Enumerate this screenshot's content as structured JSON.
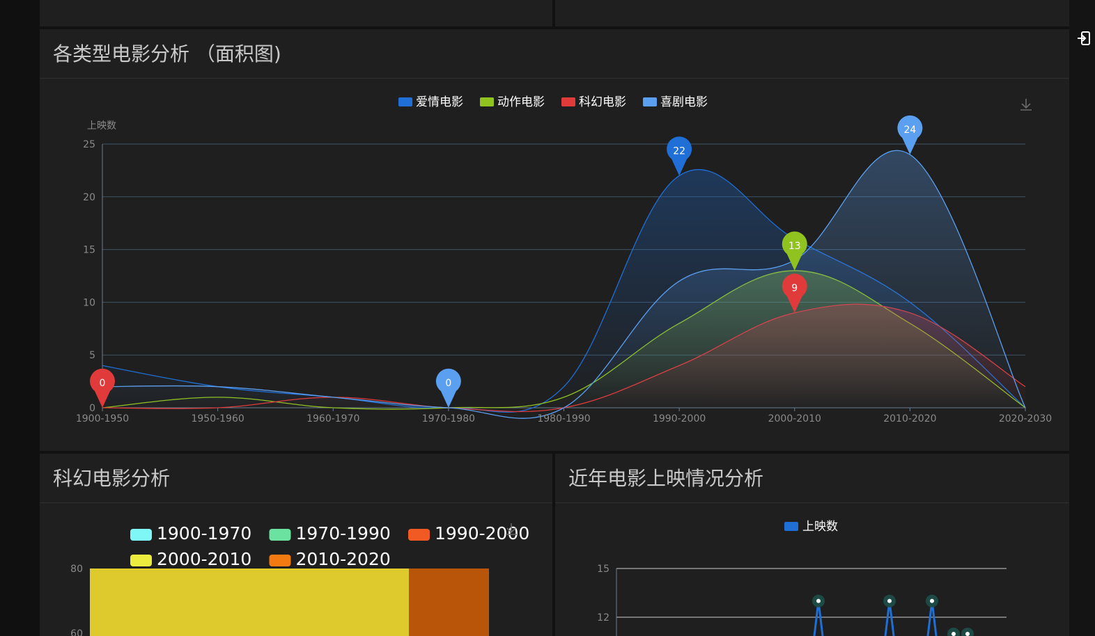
{
  "header": {
    "logout_label": "退出",
    "logout_icon": "logout-icon"
  },
  "panels": {
    "area": {
      "title": "各类型电影分析 （面积图)"
    },
    "scifi": {
      "title": "科幻电影分析"
    },
    "recent": {
      "title": "近年电影上映情况分析"
    }
  },
  "chart_data": [
    {
      "type": "area",
      "title": "各类型电影分析 （面积图)",
      "ylabel": "上映数",
      "ylim": [
        0,
        25
      ],
      "yticks": [
        0,
        5,
        10,
        15,
        20,
        25
      ],
      "grid": true,
      "legend_position": "top-center",
      "categories": [
        "1900-1950",
        "1950-1960",
        "1960-1970",
        "1970-1980",
        "1980-1990",
        "1990-2000",
        "2000-2010",
        "2010-2020",
        "2020-2030"
      ],
      "series": [
        {
          "name": "爱情电影",
          "color": "#1f6fd6",
          "values": [
            4,
            2,
            1,
            0,
            2,
            22,
            16,
            10,
            0
          ]
        },
        {
          "name": "动作电影",
          "color": "#91c320",
          "values": [
            0,
            1,
            0,
            0,
            1,
            8,
            13,
            8,
            0
          ]
        },
        {
          "name": "科幻电影",
          "color": "#e03a3a",
          "values": [
            0,
            0,
            1,
            0,
            0,
            4,
            9,
            9,
            2
          ]
        },
        {
          "name": "喜剧电影",
          "color": "#5b9ff0",
          "values": [
            2,
            2,
            1,
            0,
            0,
            12,
            14,
            24,
            0
          ]
        }
      ],
      "markers": [
        {
          "series": "科幻电影",
          "category": "1900-1950",
          "label": "0"
        },
        {
          "series": "喜剧电影",
          "category": "1970-1980",
          "label": "0"
        },
        {
          "series": "爱情电影",
          "category": "1990-2000",
          "label": "22"
        },
        {
          "series": "动作电影",
          "category": "2000-2010",
          "label": "13"
        },
        {
          "series": "科幻电影",
          "category": "2000-2010",
          "label": "9"
        },
        {
          "series": "喜剧电影",
          "category": "2010-2020",
          "label": "24"
        }
      ],
      "toolbox": "download-icon"
    },
    {
      "type": "bar",
      "title": "科幻电影分析",
      "legend_position": "top",
      "series": [
        {
          "name": "1900-1970",
          "color": "#7ff7f7"
        },
        {
          "name": "1970-1990",
          "color": "#6be2a0"
        },
        {
          "name": "1990-2000",
          "color": "#f25a24"
        },
        {
          "name": "2000-2010",
          "color": "#ecec3e"
        },
        {
          "name": "2010-2020",
          "color": "#f27a10"
        }
      ],
      "yticks": [
        80,
        60
      ],
      "visible_bars": [
        {
          "series": "2000-2010",
          "value": 80,
          "color": "#dfca2e"
        },
        {
          "series": "2010-2020",
          "value": 80,
          "color": "#b85508"
        }
      ],
      "toolbox": "download-icon"
    },
    {
      "type": "line",
      "title": "近年电影上映情况分析",
      "legend_position": "top-center",
      "series": [
        {
          "name": "上映数",
          "color": "#1f6fd6"
        }
      ],
      "yticks": [
        15,
        12
      ],
      "visible_peaks": [
        13,
        13,
        13
      ]
    }
  ]
}
